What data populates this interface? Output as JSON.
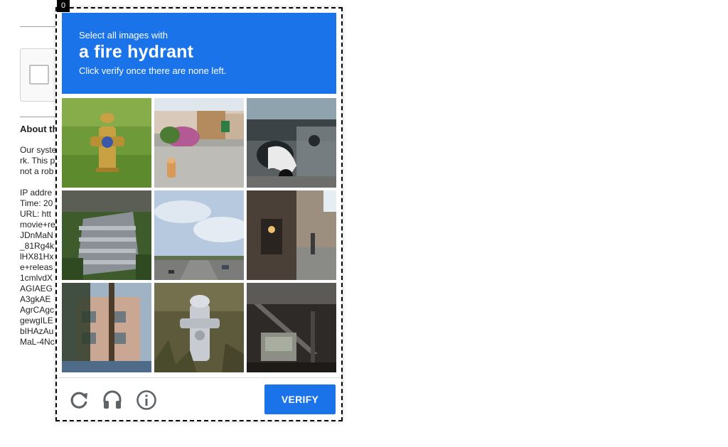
{
  "popup_index": "0",
  "challenge": {
    "instruction_prefix": "Select all images with",
    "target_object": "a fire hydrant",
    "hint": "Click verify once there are none left.",
    "tiles": [
      {
        "label": "fire hydrant on grass"
      },
      {
        "label": "sidewalk with small hydrant and flowers"
      },
      {
        "label": "parked scooters"
      },
      {
        "label": "stone steps"
      },
      {
        "label": "highway under sky"
      },
      {
        "label": "street with shop fronts"
      },
      {
        "label": "apartment building behind tree"
      },
      {
        "label": "silver fire hydrant in weeds"
      },
      {
        "label": "metal stairway"
      }
    ],
    "verify_label": "VERIFY",
    "footer_icons": [
      "reload-icon",
      "audio-challenge-icon",
      "info-icon"
    ]
  },
  "background": {
    "about_title": "About th",
    "lines": [
      "Our syste",
      "rk. This p",
      "not a rob",
      "",
      "IP addre",
      "Time: 20",
      "URL: htt",
      "movie+re",
      "JDnMaN",
      "_81Rg4k",
      "lHX81Hx",
      "e+releas",
      "1cmlvdX",
      "AGIAEG",
      "A3gkAE",
      "AgrCAgc",
      "gewgILE",
      "bIHAzAu",
      "MaL-4Nc"
    ]
  },
  "colors": {
    "accent": "#1a73e8",
    "header_text": "#ffffff"
  }
}
